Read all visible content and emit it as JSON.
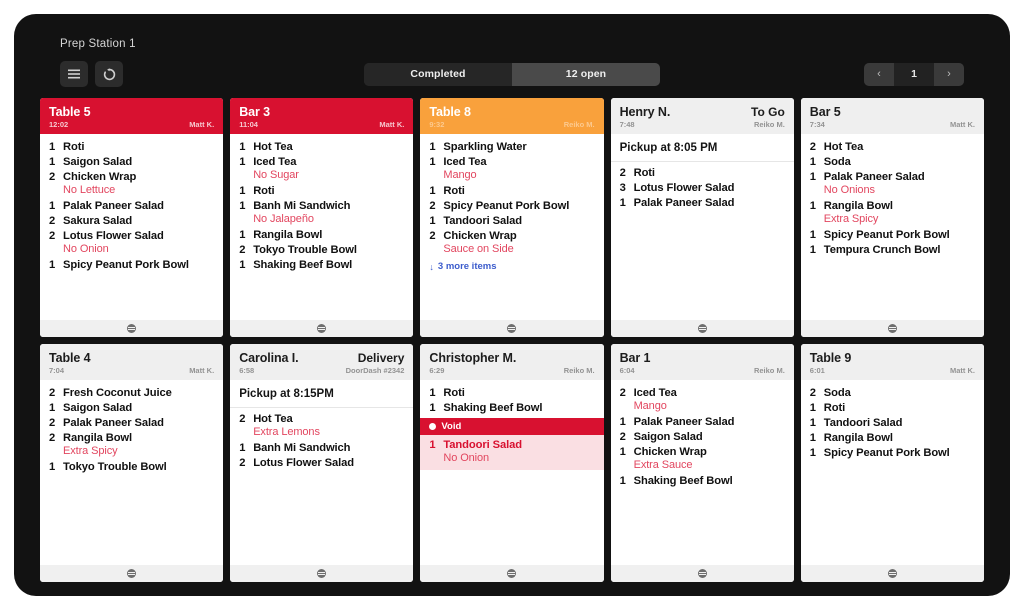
{
  "header": {
    "station_title": "Prep Station 1",
    "menu_icon": "hamburger-menu-icon",
    "refresh_icon": "refresh-icon",
    "tabs": [
      {
        "label": "Completed",
        "active": false
      },
      {
        "label": "12 open",
        "active": true
      }
    ],
    "pager": {
      "prev": "‹",
      "page": "1",
      "next": "›"
    }
  },
  "cards": [
    {
      "title": "Table 5",
      "type": "",
      "time": "12:02",
      "server": "Matt K.",
      "color": "red",
      "pickup": "",
      "lines": [
        {
          "qty": "1",
          "item": "Roti",
          "mod": ""
        },
        {
          "qty": "1",
          "item": "Saigon Salad",
          "mod": ""
        },
        {
          "qty": "2",
          "item": "Chicken Wrap",
          "mod": "No Lettuce"
        },
        {
          "qty": "1",
          "item": "Palak Paneer Salad",
          "mod": ""
        },
        {
          "qty": "2",
          "item": "Sakura Salad",
          "mod": ""
        },
        {
          "qty": "2",
          "item": "Lotus Flower Salad",
          "mod": "No Onion"
        },
        {
          "qty": "1",
          "item": "Spicy Peanut Pork Bowl",
          "mod": ""
        }
      ],
      "more": "",
      "void": null
    },
    {
      "title": "Bar 3",
      "type": "",
      "time": "11:04",
      "server": "Matt K.",
      "color": "red",
      "pickup": "",
      "lines": [
        {
          "qty": "1",
          "item": "Hot Tea",
          "mod": ""
        },
        {
          "qty": "1",
          "item": "Iced Tea",
          "mod": "No Sugar"
        },
        {
          "qty": "1",
          "item": "Roti",
          "mod": ""
        },
        {
          "qty": "1",
          "item": "Banh Mi Sandwich",
          "mod": "No Jalapeño"
        },
        {
          "qty": "1",
          "item": "Rangila Bowl",
          "mod": ""
        },
        {
          "qty": "2",
          "item": "Tokyo Trouble Bowl",
          "mod": ""
        },
        {
          "qty": "1",
          "item": "Shaking Beef Bowl",
          "mod": ""
        }
      ],
      "more": "",
      "void": null
    },
    {
      "title": "Table 8",
      "type": "",
      "time": "9:32",
      "server": "Reiko M.",
      "color": "orange",
      "pickup": "",
      "lines": [
        {
          "qty": "1",
          "item": "Sparkling Water",
          "mod": ""
        },
        {
          "qty": "1",
          "item": "Iced Tea",
          "mod": "Mango"
        },
        {
          "qty": "1",
          "item": "Roti",
          "mod": ""
        },
        {
          "qty": "2",
          "item": "Spicy Peanut Pork Bowl",
          "mod": ""
        },
        {
          "qty": "1",
          "item": "Tandoori Salad",
          "mod": ""
        },
        {
          "qty": "2",
          "item": "Chicken Wrap",
          "mod": "Sauce on Side"
        }
      ],
      "more": "3 more items",
      "void": null
    },
    {
      "title": "Henry N.",
      "type": "To Go",
      "time": "7:48",
      "server": "Reiko M.",
      "color": "plain",
      "pickup": "Pickup at 8:05 PM",
      "lines": [
        {
          "qty": "2",
          "item": "Roti",
          "mod": ""
        },
        {
          "qty": "3",
          "item": "Lotus Flower Salad",
          "mod": ""
        },
        {
          "qty": "1",
          "item": "Palak Paneer Salad",
          "mod": ""
        }
      ],
      "more": "",
      "void": null
    },
    {
      "title": "Bar 5",
      "type": "",
      "time": "7:34",
      "server": "Matt K.",
      "color": "plain",
      "pickup": "",
      "lines": [
        {
          "qty": "2",
          "item": "Hot Tea",
          "mod": ""
        },
        {
          "qty": "1",
          "item": "Soda",
          "mod": ""
        },
        {
          "qty": "1",
          "item": "Palak Paneer Salad",
          "mod": "No Onions"
        },
        {
          "qty": "1",
          "item": "Rangila Bowl",
          "mod": "Extra Spicy"
        },
        {
          "qty": "1",
          "item": "Spicy Peanut Pork Bowl",
          "mod": ""
        },
        {
          "qty": "1",
          "item": "Tempura Crunch Bowl",
          "mod": ""
        }
      ],
      "more": "",
      "void": null
    },
    {
      "title": "Table 4",
      "type": "",
      "time": "7:04",
      "server": "Matt K.",
      "color": "plain",
      "pickup": "",
      "lines": [
        {
          "qty": "2",
          "item": "Fresh Coconut Juice",
          "mod": ""
        },
        {
          "qty": "1",
          "item": "Saigon Salad",
          "mod": ""
        },
        {
          "qty": "2",
          "item": "Palak Paneer Salad",
          "mod": ""
        },
        {
          "qty": "2",
          "item": "Rangila Bowl",
          "mod": "Extra Spicy"
        },
        {
          "qty": "1",
          "item": "Tokyo Trouble Bowl",
          "mod": ""
        }
      ],
      "more": "",
      "void": null
    },
    {
      "title": "Carolina I.",
      "type": "Delivery",
      "time": "6:58",
      "server": "DoorDash #2342",
      "color": "plain",
      "pickup": "Pickup at 8:15PM",
      "lines": [
        {
          "qty": "2",
          "item": "Hot Tea",
          "mod": "Extra Lemons"
        },
        {
          "qty": "1",
          "item": "Banh Mi Sandwich",
          "mod": ""
        },
        {
          "qty": "2",
          "item": "Lotus Flower Salad",
          "mod": ""
        }
      ],
      "more": "",
      "void": null
    },
    {
      "title": "Christopher M.",
      "type": "",
      "time": "6:29",
      "server": "Reiko M.",
      "color": "plain",
      "pickup": "",
      "lines": [
        {
          "qty": "1",
          "item": "Roti",
          "mod": ""
        },
        {
          "qty": "1",
          "item": "Shaking Beef Bowl",
          "mod": ""
        }
      ],
      "more": "",
      "void": {
        "label": "Void",
        "lines": [
          {
            "qty": "1",
            "item": "Tandoori Salad",
            "mod": "No Onion"
          }
        ]
      }
    },
    {
      "title": "Bar 1",
      "type": "",
      "time": "6:04",
      "server": "Reiko M.",
      "color": "plain",
      "pickup": "",
      "lines": [
        {
          "qty": "2",
          "item": "Iced Tea",
          "mod": "Mango"
        },
        {
          "qty": "1",
          "item": "Palak Paneer Salad",
          "mod": ""
        },
        {
          "qty": "2",
          "item": "Saigon Salad",
          "mod": ""
        },
        {
          "qty": "1",
          "item": "Chicken Wrap",
          "mod": "Extra Sauce"
        },
        {
          "qty": "1",
          "item": "Shaking Beef Bowl",
          "mod": ""
        }
      ],
      "more": "",
      "void": null
    },
    {
      "title": "Table 9",
      "type": "",
      "time": "6:01",
      "server": "Matt K.",
      "color": "plain",
      "pickup": "",
      "lines": [
        {
          "qty": "2",
          "item": "Soda",
          "mod": ""
        },
        {
          "qty": "1",
          "item": "Roti",
          "mod": ""
        },
        {
          "qty": "1",
          "item": "Tandoori Salad",
          "mod": ""
        },
        {
          "qty": "1",
          "item": "Rangila Bowl",
          "mod": ""
        },
        {
          "qty": "1",
          "item": "Spicy Peanut Pork Bowl",
          "mod": ""
        }
      ],
      "more": "",
      "void": null
    }
  ],
  "colors": {
    "urgent_red": "#d81130",
    "warning_orange": "#f9a13c",
    "modifier_red": "#e2465f",
    "link_blue": "#3c5ccc"
  }
}
